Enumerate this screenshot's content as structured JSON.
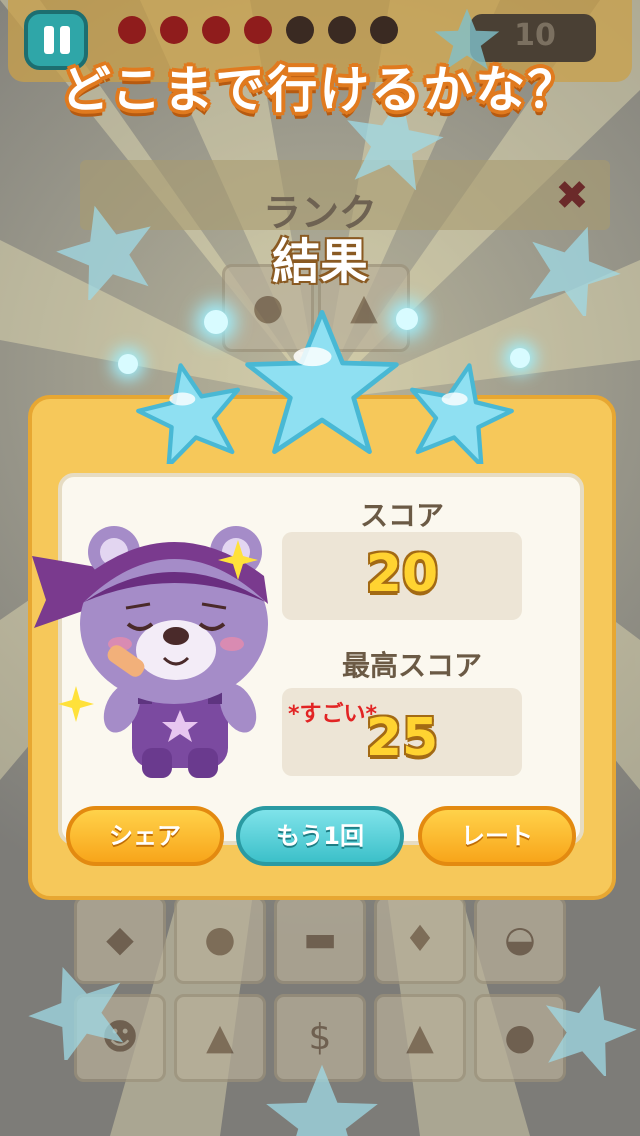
{
  "hud": {
    "star_count": "10",
    "icons": [
      "pause-icon",
      "cherry-icon",
      "star-icon"
    ]
  },
  "headline": "どこまで行けるかな？",
  "background": {
    "rank_label": "ランク",
    "shelf_icons": [
      "bear",
      "popcorn",
      "fish",
      "globe",
      "table",
      "lantern",
      "teapot",
      "monster",
      "lamp",
      "money-bag",
      "popcorn",
      "bear"
    ]
  },
  "result": {
    "title": "結果",
    "stars_earned": 3,
    "score_label": "スコア",
    "score_value": "20",
    "best_label": "最高スコア",
    "best_badge": "*すごい*",
    "best_value": "25",
    "character": "purple-bear-with-bandana"
  },
  "buttons": {
    "share": "シェア",
    "retry": "もう1回",
    "rate": "レート"
  },
  "colors": {
    "panel": "#f6c85a",
    "star": "#8fe0f2",
    "score_text": "#ffd331",
    "orange_button": "#f8a51a",
    "teal_button": "#3cc0c9",
    "badge_red": "#e22424"
  }
}
